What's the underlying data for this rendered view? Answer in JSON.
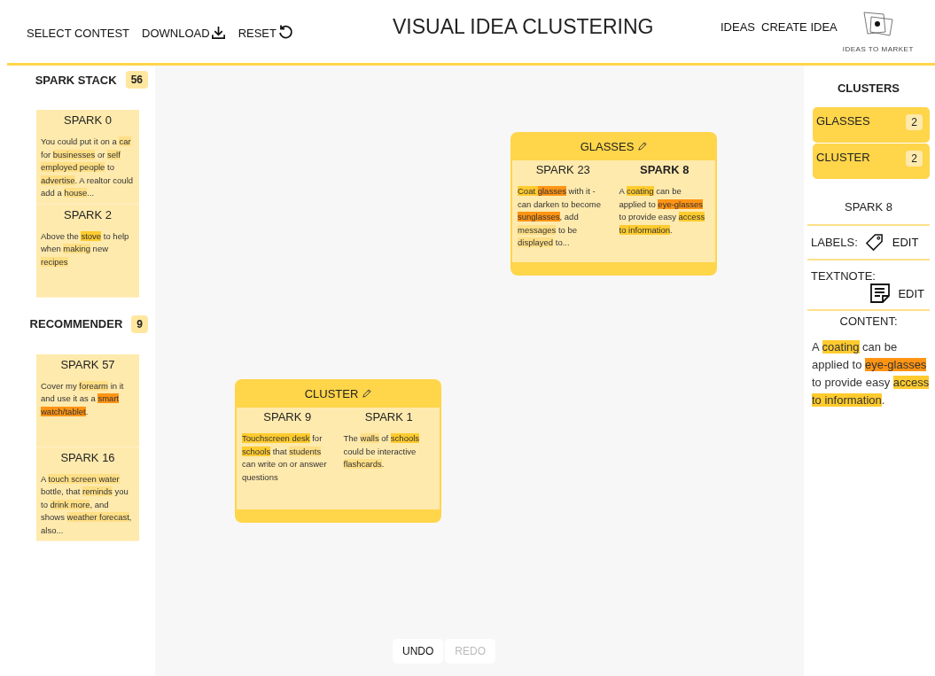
{
  "header": {
    "nav_left": [
      "SELECT CONTEST",
      "DOWNLOAD",
      "RESET"
    ],
    "title": "VISUAL IDEA CLUSTERING",
    "nav_right": [
      "IDEAS",
      "CREATE IDEA"
    ],
    "logo_text": "IDEAS TO MARKET"
  },
  "spark_stack": {
    "title": "SPARK STACK",
    "count": "56",
    "sparks": [
      {
        "title": "SPARK 0",
        "text": [
          {
            "text": "You could put it on a "
          },
          {
            "text": "car",
            "color": "#ffdf85"
          },
          {
            "text": " for "
          },
          {
            "text": "businesses",
            "color": "#ffdf85"
          },
          {
            "text": " or "
          },
          {
            "text": "self employed people",
            "color": "#ffdf85"
          },
          {
            "text": " to "
          },
          {
            "text": "advertise",
            "color": "#ffdf85"
          },
          {
            "text": ". A realtor could add a "
          },
          {
            "text": "house",
            "color": "#ffdf85"
          },
          {
            "text": "..."
          }
        ]
      },
      {
        "title": "SPARK 2",
        "text": [
          {
            "text": "Above the "
          },
          {
            "text": "stove",
            "color": "#ffcb2e"
          },
          {
            "text": " to help when "
          },
          {
            "text": "making",
            "color": "#ffdf85"
          },
          {
            "text": " new "
          },
          {
            "text": "recipes",
            "color": "#ffdf85"
          }
        ]
      }
    ]
  },
  "recommender": {
    "title": "RECOMMENDER",
    "count": "9",
    "sparks": [
      {
        "title": "SPARK 57",
        "text": [
          {
            "text": "Cover my "
          },
          {
            "text": "forearm",
            "color": "#ffdf85"
          },
          {
            "text": " in it and use it as a "
          },
          {
            "text": "smart watch/tablet",
            "color": "#ff9414"
          },
          {
            "text": "."
          }
        ]
      },
      {
        "title": "SPARK 16",
        "text": [
          {
            "text": "A "
          },
          {
            "text": "touch screen water",
            "color": "#ffdf85"
          },
          {
            "text": " bottle, that "
          },
          {
            "text": "reminds",
            "color": "#ffdf85"
          },
          {
            "text": " you to "
          },
          {
            "text": "drink more",
            "color": "#ffdf85"
          },
          {
            "text": ", and shows "
          },
          {
            "text": "weather forecast",
            "color": "#ffdf85"
          },
          {
            "text": ", also..."
          }
        ]
      }
    ]
  },
  "canvas": {
    "clusters": [
      {
        "name": "GLASSES",
        "sparks": [
          {
            "title": "SPARK 23",
            "selected": false,
            "text": [
              {
                "text": "Coat ",
                "color": "#ffcb2e"
              },
              {
                "text": "glasses",
                "color": "#ff9414"
              },
              {
                "text": " with it - can darken to become "
              },
              {
                "text": "sunglasses",
                "color": "#ff9414"
              },
              {
                "text": ", add "
              },
              {
                "text": "messages",
                "color": "#ffdf85"
              },
              {
                "text": " to be "
              },
              {
                "text": "displayed",
                "color": "#ffdf85"
              },
              {
                "text": " to..."
              }
            ]
          },
          {
            "title": "SPARK 8",
            "selected": true,
            "text": [
              {
                "text": "A "
              },
              {
                "text": "coating",
                "color": "#ffcb2e"
              },
              {
                "text": " can be applied to "
              },
              {
                "text": "eye-glasses",
                "color": "#ff9414"
              },
              {
                "text": " to provide easy "
              },
              {
                "text": "access to information",
                "color": "#ffcb2e"
              },
              {
                "text": "."
              }
            ]
          }
        ]
      },
      {
        "name": "CLUSTER",
        "sparks": [
          {
            "title": "SPARK 9",
            "selected": false,
            "text": [
              {
                "text": "Touchscreen desk",
                "color": "#ffcb2e"
              },
              {
                "text": " for "
              },
              {
                "text": "schools",
                "color": "#ffcb2e"
              },
              {
                "text": " that "
              },
              {
                "text": "students",
                "color": "#ffdf85"
              },
              {
                "text": " can write on or answer questions"
              }
            ]
          },
          {
            "title": "SPARK 1",
            "selected": false,
            "text": [
              {
                "text": "The "
              },
              {
                "text": "walls",
                "color": "#ffdf85"
              },
              {
                "text": " of "
              },
              {
                "text": "schools",
                "color": "#ffcb2e"
              },
              {
                "text": " could be interactive "
              },
              {
                "text": "flashcards",
                "color": "#ffdf85"
              },
              {
                "text": "."
              }
            ]
          }
        ]
      }
    ],
    "history": [
      {
        "label": "UNDO",
        "disabled": false
      },
      {
        "label": "REDO",
        "disabled": true
      }
    ]
  },
  "clusters_panel": {
    "title": "CLUSTERS",
    "items": [
      {
        "name": "GLASSES",
        "count": "2"
      },
      {
        "name": "CLUSTER",
        "count": "2"
      }
    ]
  },
  "detail": {
    "spark": "SPARK 8",
    "labels": "LABELS:",
    "labels_edit": "EDIT",
    "textnote": "TEXTNOTE:",
    "textnote_edit": "EDIT",
    "content_title": "CONTENT:",
    "content": [
      {
        "text": "A "
      },
      {
        "text": "coating",
        "color": "#ffcb2e"
      },
      {
        "text": " can be applied to "
      },
      {
        "text": "eye-glasses",
        "color": "#ff9414"
      },
      {
        "text": " to provide easy "
      },
      {
        "text": "access to information",
        "color": "#ffcb2e"
      },
      {
        "text": "."
      }
    ]
  }
}
